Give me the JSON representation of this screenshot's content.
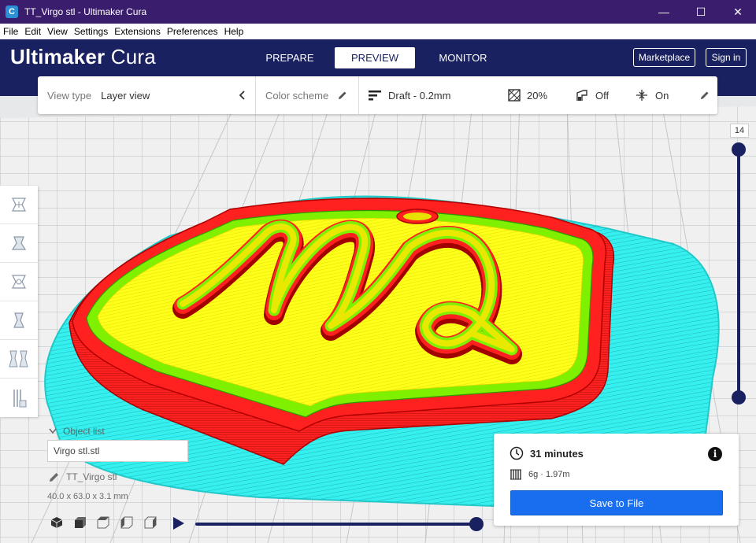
{
  "window": {
    "title": "TT_Virgo stl - Ultimaker Cura",
    "app_icon": "C",
    "controls": {
      "minimize": "—",
      "maximize": "☐",
      "close": "✕"
    }
  },
  "menubar": [
    "File",
    "Edit",
    "View",
    "Settings",
    "Extensions",
    "Preferences",
    "Help"
  ],
  "header": {
    "logo_bold": "Ultimaker",
    "logo_light": " Cura",
    "tabs": [
      {
        "label": "PREPARE",
        "active": false
      },
      {
        "label": "PREVIEW",
        "active": true
      },
      {
        "label": "MONITOR",
        "active": false
      }
    ],
    "marketplace": "Marketplace",
    "sign_in": "Sign in"
  },
  "viewbar": {
    "view_type_label": "View type",
    "view_type_value": "Layer view",
    "color_scheme_label": "Color scheme",
    "profile": "Draft - 0.2mm",
    "infill": "20%",
    "support": "Off",
    "adhesion": "On"
  },
  "layer_slider": {
    "current_layer": "14"
  },
  "object_list": {
    "header": "Object list",
    "file": "Virgo stl.stl",
    "object_name": "TT_Virgo stl",
    "dimensions": "40.0 x 63.0 x 3.1 mm"
  },
  "simulation": {
    "progress": 1.0
  },
  "print_info": {
    "time": "31 minutes",
    "material": "6g · 1.97m",
    "save_label": "Save to File"
  },
  "colors": {
    "header_bg": "#192161",
    "titlebar_bg": "#3b1d6e",
    "accent_blue": "#196ef0",
    "wall_red": "#ff1e1e",
    "infill_yellow": "#ffff00",
    "inner_wall_green": "#40e000",
    "skirt_cyan": "#2ef2f2"
  }
}
